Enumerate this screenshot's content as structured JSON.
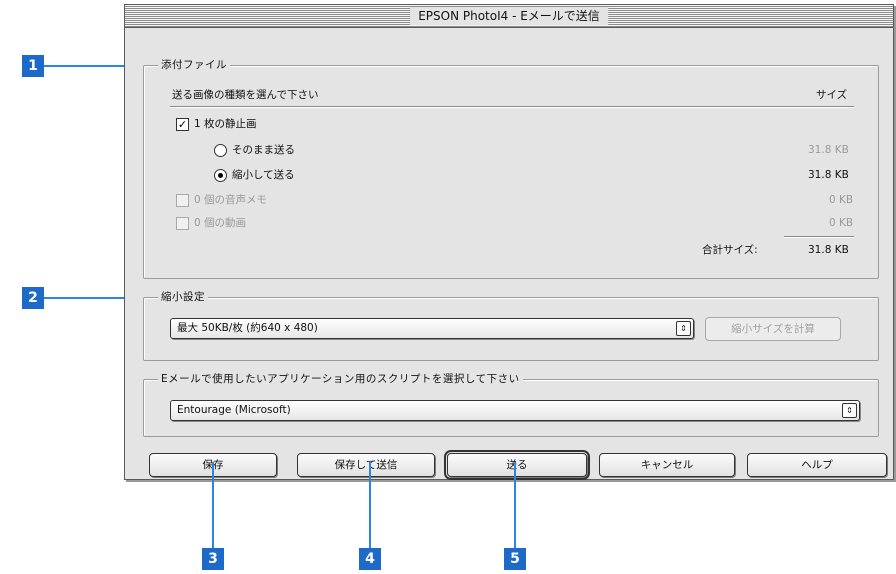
{
  "window": {
    "title": "EPSON PhotoI4 - Eメールで送信"
  },
  "attachments": {
    "legend": "添付ファイル",
    "header_label": "送る画像の種類を選んで下さい",
    "header_size": "サイズ",
    "still_images": {
      "label": "1 枚の静止画",
      "checked_mark": "✓"
    },
    "send_as_is": {
      "label": "そのまま送る",
      "size": "31.8 KB"
    },
    "send_reduced": {
      "label": "縮小して送る",
      "size": "31.8 KB"
    },
    "voice_memos": {
      "label": "0 個の音声メモ",
      "size": "0 KB"
    },
    "movies": {
      "label": "0 個の動画",
      "size": "0 KB"
    },
    "total_label": "合計サイズ:",
    "total_value": "31.8 KB"
  },
  "reduce": {
    "legend": "縮小設定",
    "selected": "最大 50KB/枚 (約640 x 480)",
    "calc_button": "縮小サイズを計算",
    "arrow_glyph": "⇕"
  },
  "script": {
    "legend": "Eメールで使用したいアプリケーション用のスクリプトを選択して下さい",
    "selected": "Entourage (Microsoft)",
    "arrow_glyph": "⇕"
  },
  "buttons": {
    "save": "保存",
    "save_and_send": "保存して送信",
    "send": "送る",
    "cancel": "キャンセル",
    "help": "ヘルプ"
  },
  "callouts": [
    "1",
    "2",
    "3",
    "4",
    "5"
  ],
  "colors": {
    "callout": "#1e6ac8",
    "leader": "#2a86e0",
    "window_bg": "#e4e4e4"
  }
}
